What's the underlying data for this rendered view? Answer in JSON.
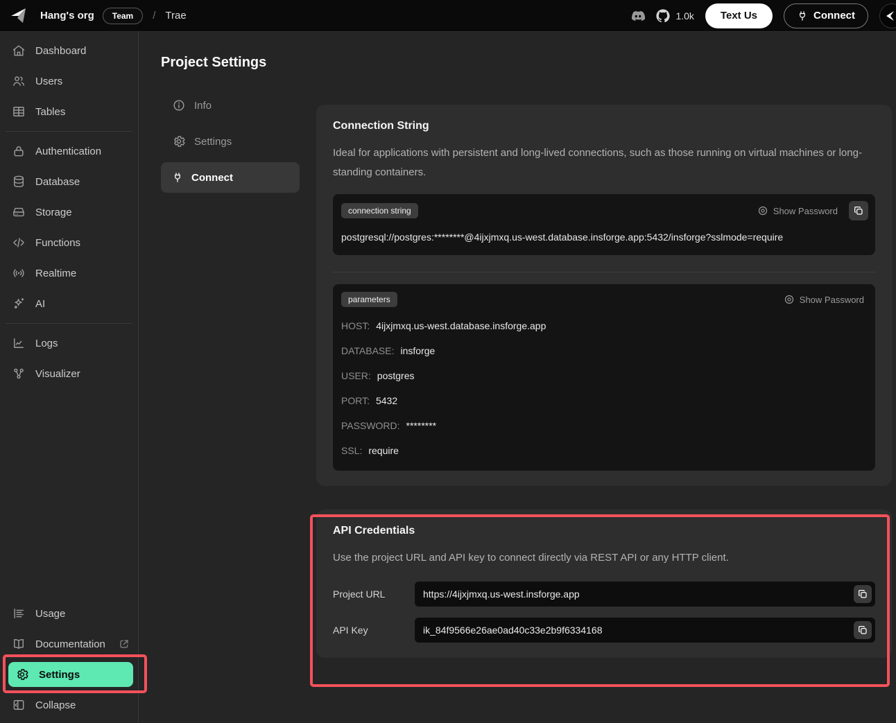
{
  "topbar": {
    "org_name": "Hang's org",
    "team_badge": "Team",
    "breadcrumb_separator": "/",
    "project_name": "Trae",
    "github_stars": "1.0k",
    "text_us_label": "Text Us",
    "connect_label": "Connect"
  },
  "sidebar": {
    "items": [
      {
        "label": "Dashboard",
        "icon": "home-icon"
      },
      {
        "label": "Users",
        "icon": "users-icon"
      },
      {
        "label": "Tables",
        "icon": "table-icon"
      },
      {
        "label": "Authentication",
        "icon": "lock-icon"
      },
      {
        "label": "Database",
        "icon": "database-icon"
      },
      {
        "label": "Storage",
        "icon": "storage-icon"
      },
      {
        "label": "Functions",
        "icon": "code-icon"
      },
      {
        "label": "Realtime",
        "icon": "broadcast-icon"
      },
      {
        "label": "AI",
        "icon": "sparkle-icon"
      },
      {
        "label": "Logs",
        "icon": "chart-icon"
      },
      {
        "label": "Visualizer",
        "icon": "network-icon"
      }
    ],
    "footer": [
      {
        "label": "Usage",
        "icon": "list-icon"
      },
      {
        "label": "Documentation",
        "icon": "book-icon",
        "trailing_icon": "external-link-icon"
      },
      {
        "label": "Settings",
        "icon": "gear-icon",
        "active": true
      },
      {
        "label": "Collapse",
        "icon": "collapse-panel-icon"
      }
    ]
  },
  "main": {
    "title": "Project Settings",
    "subnav": [
      {
        "label": "Info",
        "icon": "info-icon"
      },
      {
        "label": "Settings",
        "icon": "gear-icon"
      },
      {
        "label": "Connect",
        "icon": "plug-icon",
        "selected": true
      }
    ],
    "connection_card": {
      "title": "Connection String",
      "description": "Ideal for applications with persistent and long-lived connections, such as those running on virtual machines or long-standing containers.",
      "connection_string": {
        "badge": "connection string",
        "show_password_label": "Show Password",
        "value": "postgresql://postgres:********@4ijxjmxq.us-west.database.insforge.app:5432/insforge?sslmode=require"
      },
      "parameters": {
        "badge": "parameters",
        "show_password_label": "Show Password",
        "rows": [
          {
            "label": "HOST:",
            "value": "4ijxjmxq.us-west.database.insforge.app"
          },
          {
            "label": "DATABASE:",
            "value": "insforge"
          },
          {
            "label": "USER:",
            "value": "postgres"
          },
          {
            "label": "PORT:",
            "value": "5432"
          },
          {
            "label": "PASSWORD:",
            "value": "********"
          },
          {
            "label": "SSL:",
            "value": "require"
          }
        ]
      }
    },
    "api_card": {
      "title": "API Credentials",
      "description": "Use the project URL and API key to connect directly via REST API or any HTTP client.",
      "rows": [
        {
          "label": "Project URL",
          "value": "https://4ijxjmxq.us-west.insforge.app"
        },
        {
          "label": "API Key",
          "value": "ik_84f9566e26ae0ad40c33e2b9f6334168"
        }
      ]
    }
  },
  "colors": {
    "accent_green": "#5ee9b2",
    "annotation_red": "#f4515b",
    "topbar_bg": "#0a0a0a",
    "card_bg": "#2e2e2e",
    "inner_box_bg": "#141414"
  }
}
